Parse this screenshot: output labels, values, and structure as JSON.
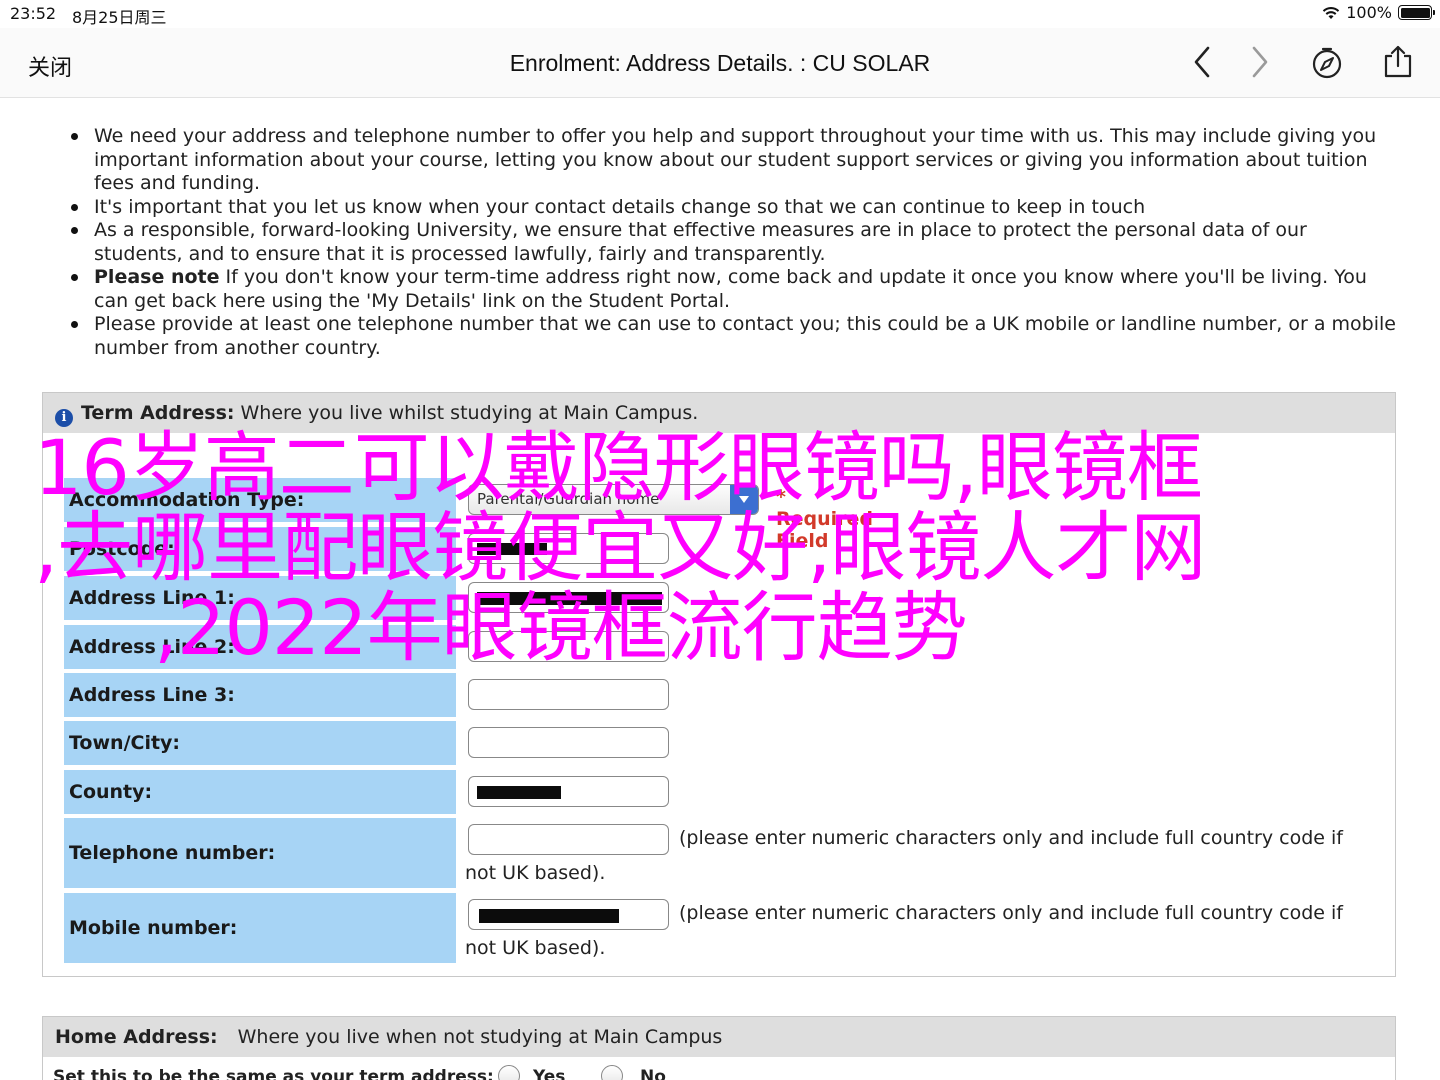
{
  "status_bar": {
    "time": "23:52",
    "date": "8月25日周三",
    "battery": "100%"
  },
  "nav": {
    "close_label": "关闭",
    "title": "Enrolment: Address Details. : CU SOLAR"
  },
  "bullets": [
    {
      "bold": "",
      "text": "We need your address and telephone number to offer you help and support throughout your time with us. This may include giving you important information about your course, letting you know about our student support services or giving you information about tuition fees and funding."
    },
    {
      "bold": "",
      "text": "It's important that you let us know when your contact details change so that we can continue to keep in touch"
    },
    {
      "bold": "",
      "text": "As a responsible, forward-looking University, we ensure that effective measures are in place to protect the personal data of our students, and to ensure that it is processed lawfully, fairly and transparently."
    },
    {
      "bold": "Please note",
      "text": " If you don't know your term-time address right now, come back and update it once you know where you'll be living. You can get back here using the 'My Details' link on the Student Portal."
    },
    {
      "bold": "",
      "text": "Please provide at least one telephone number that we can use to contact you; this could be a UK mobile or landline number, or a mobile number from another country."
    }
  ],
  "term_address": {
    "heading": "Term Address:",
    "heading_desc": " Where you live whilst studying at Main Campus.",
    "accommodation": {
      "label": "Accommodation Type:",
      "selected": "Parental/Guardian home",
      "required": "* Required Field"
    },
    "postcode": {
      "label": "Postcode:"
    },
    "address1": {
      "label": "Address Line 1:"
    },
    "address2": {
      "label": "Address Line 2:"
    },
    "address3": {
      "label": "Address Line 3:",
      "value": ""
    },
    "town": {
      "label": "Town/City:",
      "value": ""
    },
    "county": {
      "label": "County:"
    },
    "telephone": {
      "label": "Telephone number:",
      "value": "",
      "note": "(please enter numeric characters only and include full country code if",
      "note2": "not UK based)."
    },
    "mobile": {
      "label": "Mobile number:",
      "note": "(please enter numeric characters only and include full country code if",
      "note2": "not UK based)."
    }
  },
  "home_address": {
    "heading": "Home Address:",
    "heading_desc": "Where you live when not studying at Main Campus",
    "same_label": "Set this to be the same as your term address:",
    "yes": "Yes",
    "no": "No"
  },
  "overlay": {
    "line1": "16岁高二可以戴隐形眼镜吗,眼镜框",
    "line2": ",去哪里配眼镜便宜又好,眼镜人才网",
    "line3": ",2022年眼镜框流行趋势"
  }
}
